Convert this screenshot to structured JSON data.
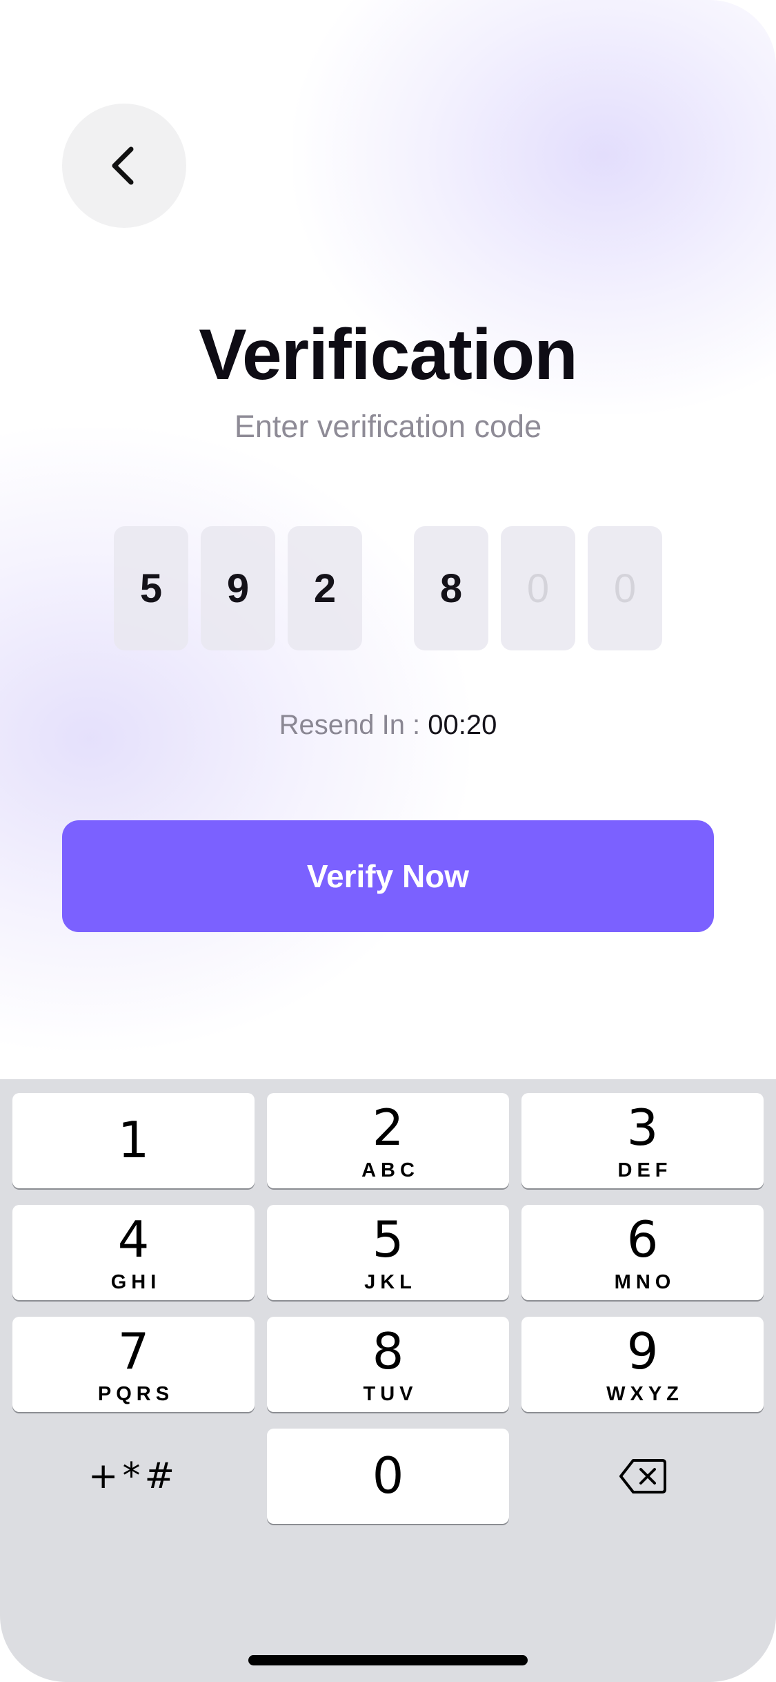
{
  "header": {
    "title": "Verification",
    "subtitle": "Enter verification code"
  },
  "otp": {
    "digits": [
      "5",
      "9",
      "2",
      "8",
      "0",
      "0"
    ],
    "filled": [
      true,
      true,
      true,
      true,
      false,
      false
    ]
  },
  "resend": {
    "label": "Resend In :",
    "time": "00:20"
  },
  "actions": {
    "verify_label": "Verify Now"
  },
  "keyboard": {
    "keys": [
      {
        "digit": "1",
        "letters": ""
      },
      {
        "digit": "2",
        "letters": "ABC"
      },
      {
        "digit": "3",
        "letters": "DEF"
      },
      {
        "digit": "4",
        "letters": "GHI"
      },
      {
        "digit": "5",
        "letters": "JKL"
      },
      {
        "digit": "6",
        "letters": "MNO"
      },
      {
        "digit": "7",
        "letters": "PQRS"
      },
      {
        "digit": "8",
        "letters": "TUV"
      },
      {
        "digit": "9",
        "letters": "WXYZ"
      },
      {
        "digit": "0",
        "letters": ""
      }
    ],
    "symbols_label": "+*#"
  },
  "colors": {
    "accent": "#7b61ff",
    "title": "#0e0c14",
    "muted": "#8e8b96",
    "keyboard_bg": "#dcdde1"
  },
  "icons": {
    "back": "chevron-left-icon",
    "delete": "delete-backspace-icon"
  }
}
